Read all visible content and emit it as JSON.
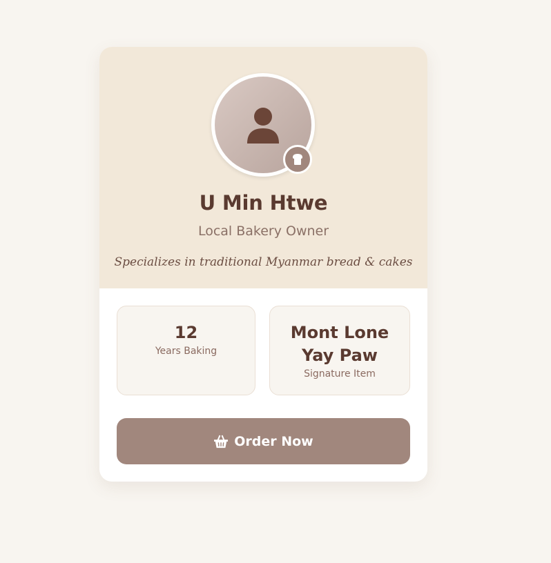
{
  "profile": {
    "name": "U Min Htwe",
    "role": "Local Bakery Owner",
    "tagline": "Specializes in traditional Myanmar bread & cakes",
    "avatar_icon": "person-icon",
    "badge_icon": "bread-icon"
  },
  "stats": [
    {
      "value": "12",
      "label": "Years Baking"
    },
    {
      "value": "Mont Lone Yay Paw",
      "label": "Signature Item"
    }
  ],
  "action": {
    "label": "Order Now",
    "icon": "basket-icon"
  },
  "colors": {
    "page_bg": "#f8f5f0",
    "hero_bg": "#f2e8d9",
    "accent": "#a1877d",
    "text_dark": "#5a3a30",
    "text_muted": "#8a7066"
  }
}
